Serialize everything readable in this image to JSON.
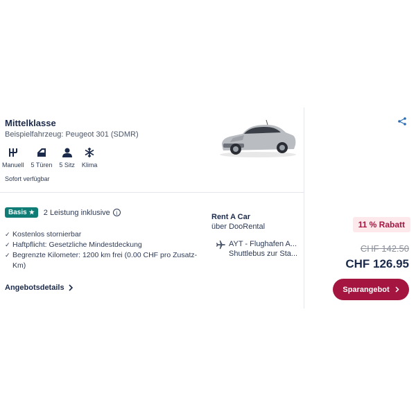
{
  "offer": {
    "category": "Mittelklasse",
    "example_vehicle": "Beispielfahrzeug: Peugeot 301 (SDMR)",
    "features": [
      {
        "label": "Manuell",
        "icon": "gearshift-icon"
      },
      {
        "label": "5 Türen",
        "icon": "car-door-icon"
      },
      {
        "label": "5 Sitz",
        "icon": "seat-person-icon"
      },
      {
        "label": "Klima",
        "icon": "snowflake-icon"
      }
    ],
    "availability": "Sofort verfügbar"
  },
  "package": {
    "badge": "Basis",
    "included": "2 Leistung inklusive",
    "benefits": [
      "Kostenlos stornierbar",
      "Haftpflicht: Gesetzliche Mindestdeckung",
      "Begrenzte Kilometer: 1200 km frei (0.00 CHF pro Zusatz-Km)"
    ],
    "details_link": "Angebotsdetails"
  },
  "provider": {
    "name": "Rent A Car",
    "via": "über DooRental",
    "location_line1": "AYT - Flughafen A...",
    "location_line2": "Shuttlebus zur Sta..."
  },
  "pricing": {
    "discount": "11 % Rabatt",
    "old_price": "CHF 142.50",
    "new_price": "CHF 126.95",
    "cta": "Sparangebot"
  },
  "colors": {
    "brand": "#a4163f",
    "badge": "#0f7d76",
    "text": "#1b2a4a",
    "link": "#2b6cb0"
  }
}
